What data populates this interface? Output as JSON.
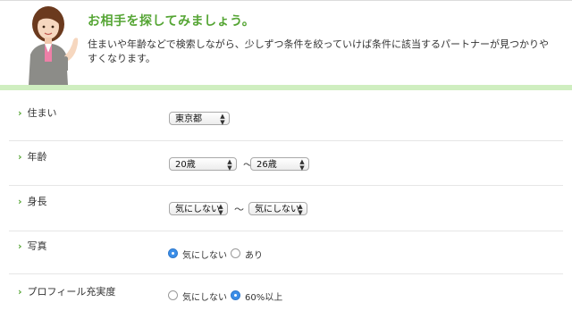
{
  "header": {
    "title": "お相手を探してみましょう。",
    "description": "住まいや年齢などで検索しながら、少しずつ条件を絞っていけば条件に該当するパートナーが見つかりやすくなります。"
  },
  "fields": {
    "residence": {
      "label": "住まい",
      "value": "東京都"
    },
    "age": {
      "label": "年齢",
      "from": "20歳",
      "to": "26歳",
      "separator": "〜"
    },
    "height": {
      "label": "身長",
      "from": "気にしない",
      "to": "気にしない",
      "separator": "〜"
    },
    "photo": {
      "label": "写真",
      "options": [
        "気にしない",
        "あり"
      ],
      "selected": "気にしない"
    },
    "profile": {
      "label": "プロフィール充実度",
      "options": [
        "気にしない",
        "60%以上"
      ],
      "selected": "60%以上"
    }
  }
}
